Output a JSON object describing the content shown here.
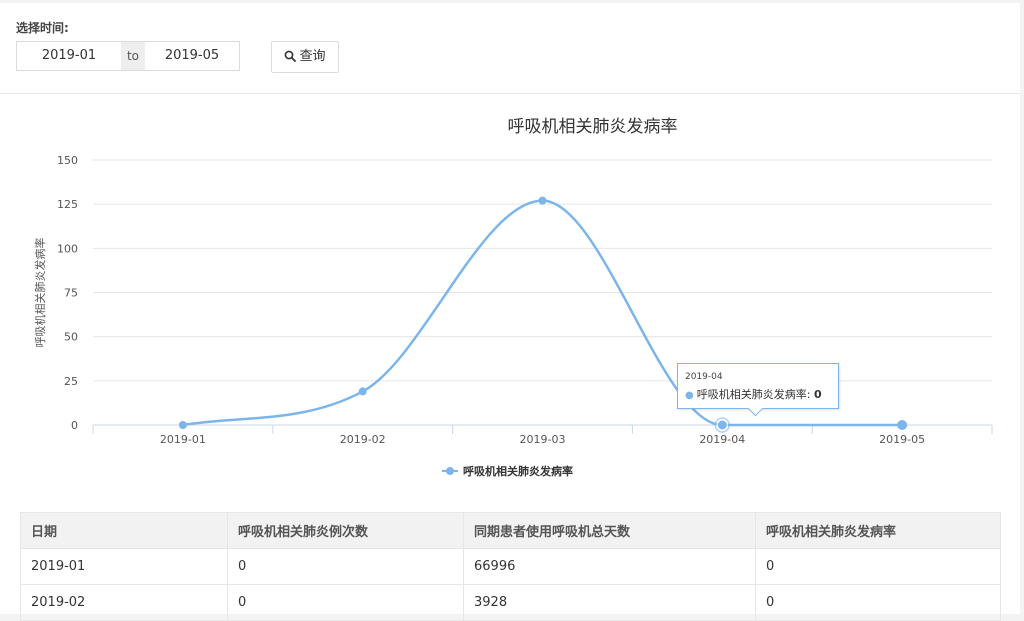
{
  "filter": {
    "label": "选择时间:",
    "from": "2019-01",
    "separator": "to",
    "to": "2019-05",
    "query_label": "查询"
  },
  "chart_data": {
    "type": "line",
    "title": "呼吸机相关肺炎发病率",
    "xlabel": "",
    "ylabel": "呼吸机相关肺炎发病率",
    "categories": [
      "2019-01",
      "2019-02",
      "2019-03",
      "2019-04",
      "2019-05"
    ],
    "yticks": [
      0,
      25,
      50,
      75,
      100,
      125,
      150
    ],
    "ylim": [
      0,
      150
    ],
    "smooth": true,
    "grid": true,
    "legend_position": "bottom",
    "series": [
      {
        "name": "呼吸机相关肺炎发病率",
        "color": "#7cb5ec",
        "values": [
          0,
          19,
          127,
          0,
          0
        ]
      }
    ],
    "tooltip": {
      "x": "2019-04",
      "series": "呼吸机相关肺炎发病率",
      "value": "0"
    }
  },
  "table": {
    "headers": [
      "日期",
      "呼吸机相关肺炎例次数",
      "同期患者使用呼吸机总天数",
      "呼吸机相关肺炎发病率"
    ],
    "rows": [
      [
        "2019-01",
        "0",
        "66996",
        "0"
      ],
      [
        "2019-02",
        "0",
        "3928",
        "0"
      ]
    ]
  }
}
